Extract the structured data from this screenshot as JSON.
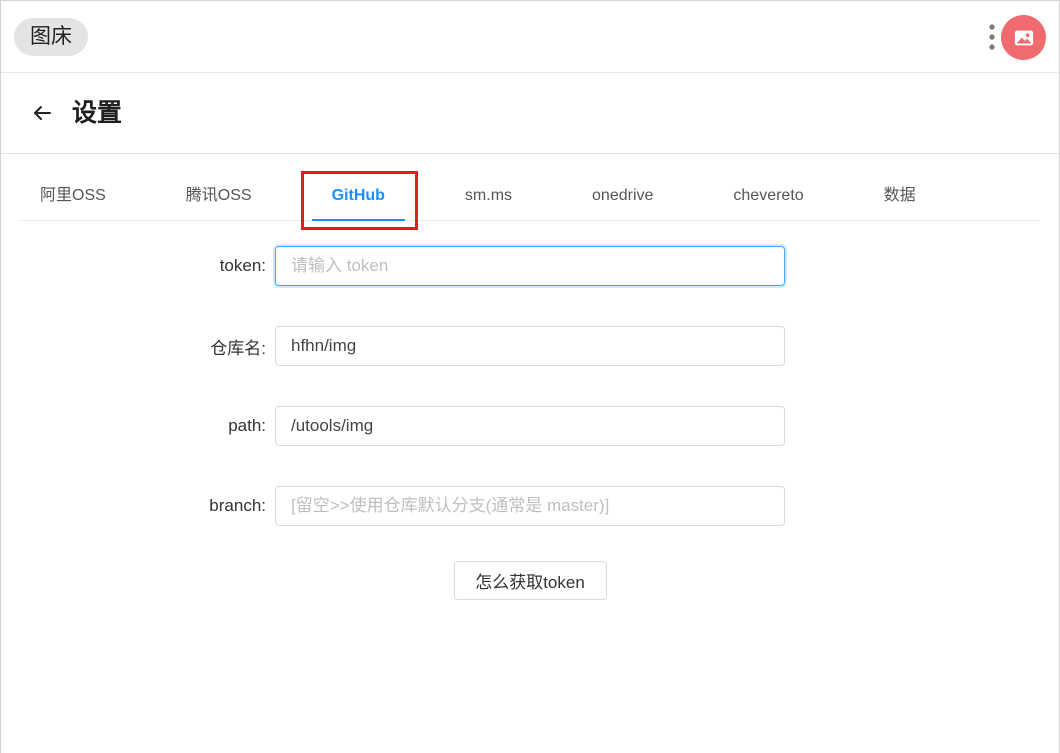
{
  "app": {
    "title": "图床"
  },
  "header": {
    "title": "设置"
  },
  "tabs": [
    {
      "label": "阿里OSS"
    },
    {
      "label": "腾讯OSS"
    },
    {
      "label": "GitHub",
      "active": true
    },
    {
      "label": "sm.ms"
    },
    {
      "label": "onedrive"
    },
    {
      "label": "chevereto"
    },
    {
      "label": "数据"
    }
  ],
  "form": {
    "fields": [
      {
        "label": "token:",
        "placeholder": "请输入 token",
        "focused": true
      },
      {
        "label": "仓库名:",
        "value": "hfhn/img"
      },
      {
        "label": "path:",
        "value": "/utools/img"
      },
      {
        "label": "branch:",
        "placeholder": "[留空>>使用仓库默认分支(通常是 master)]"
      }
    ],
    "help_button": "怎么获取token"
  },
  "icons": {
    "more": "more-vertical-icon",
    "avatar": "image-icon",
    "back": "back-arrow-icon"
  },
  "colors": {
    "accent": "#1890ff",
    "annotation_box": "#e31b23",
    "avatar_bg": "#ef6b6f",
    "pill_bg": "#e4e4e4"
  }
}
